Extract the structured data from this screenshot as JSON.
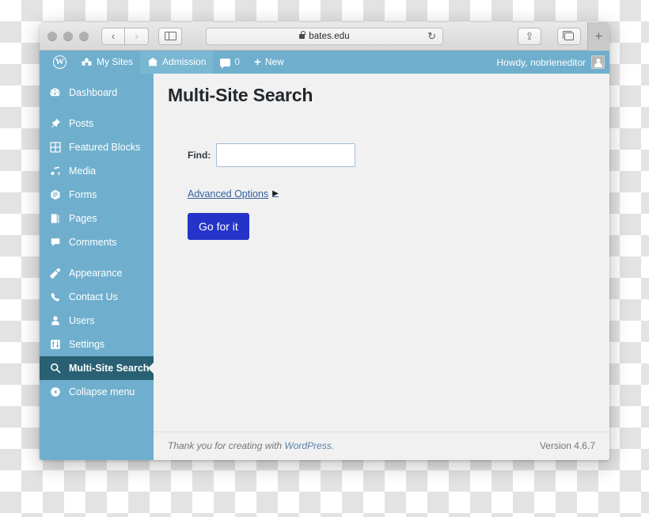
{
  "browser": {
    "url": "bates.edu",
    "lock_icon": "lock-icon",
    "reload_icon": "reload-icon",
    "back_icon": "‹",
    "forward_icon": "›",
    "sidebar_toggle_icon": "sidebar-toggle-icon",
    "share_icon": "⇧",
    "tabs_icon": "tabs-icon",
    "new_tab_label": "+"
  },
  "adminbar": {
    "wp_logo": "W",
    "my_sites_label": "My Sites",
    "my_sites_icon": "⌂",
    "site_label": "Admission",
    "site_icon": "⌂",
    "comments_count": "0",
    "comments_icon": "comment-icon",
    "new_label": "New",
    "new_icon": "+",
    "howdy_label": "Howdy, nobrieneditor",
    "avatar_icon": "user-avatar-icon"
  },
  "sidebar": {
    "items": [
      {
        "label": "Dashboard",
        "icon": "dashboard-icon",
        "key": "dashboard",
        "active": false,
        "gap_after": true
      },
      {
        "label": "Posts",
        "icon": "pin-icon",
        "key": "posts",
        "active": false,
        "gap_after": false
      },
      {
        "label": "Featured Blocks",
        "icon": "grid-icon",
        "key": "featured-blocks",
        "active": false,
        "gap_after": false
      },
      {
        "label": "Media",
        "icon": "media-icon",
        "key": "media",
        "active": false,
        "gap_after": false
      },
      {
        "label": "Forms",
        "icon": "forms-icon",
        "key": "forms",
        "active": false,
        "gap_after": false
      },
      {
        "label": "Pages",
        "icon": "pages-icon",
        "key": "pages",
        "active": false,
        "gap_after": false
      },
      {
        "label": "Comments",
        "icon": "comment-icon",
        "key": "comments",
        "active": false,
        "gap_after": true
      },
      {
        "label": "Appearance",
        "icon": "brush-icon",
        "key": "appearance",
        "active": false,
        "gap_after": false
      },
      {
        "label": "Contact Us",
        "icon": "phone-icon",
        "key": "contact-us",
        "active": false,
        "gap_after": false
      },
      {
        "label": "Users",
        "icon": "user-icon",
        "key": "users",
        "active": false,
        "gap_after": false
      },
      {
        "label": "Settings",
        "icon": "settings-icon",
        "key": "settings",
        "active": false,
        "gap_after": false
      },
      {
        "label": "Multi-Site Search",
        "icon": "search-icon",
        "key": "multi-site-search",
        "active": true,
        "gap_after": false
      },
      {
        "label": "Collapse menu",
        "icon": "collapse-icon",
        "key": "collapse-menu",
        "active": false,
        "gap_after": false
      }
    ]
  },
  "main": {
    "page_title": "Multi-Site Search",
    "find_label": "Find:",
    "find_value": "",
    "find_placeholder": "",
    "advanced_options_label": "Advanced Options",
    "advanced_options_caret": "▶",
    "submit_label": "Go for it"
  },
  "footer": {
    "thanks_prefix": "Thank you for creating with ",
    "wordpress_link": "WordPress",
    "thanks_suffix": ".",
    "version": "Version 4.6.7"
  },
  "colors": {
    "admin_blue": "#6fafcd",
    "active_menu": "#2a6074",
    "button_blue": "#2534c8",
    "content_bg": "#f1f1f1",
    "link_blue": "#2f5f9e"
  }
}
